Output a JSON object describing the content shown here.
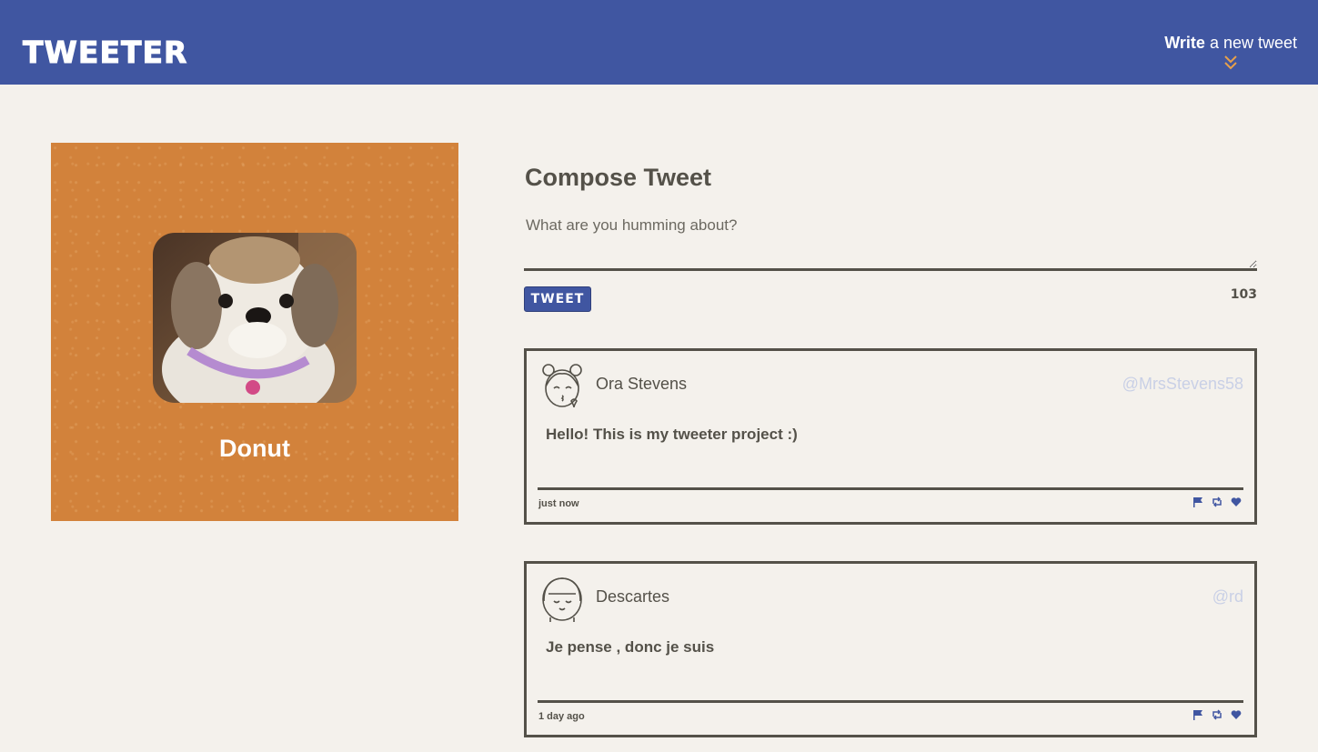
{
  "nav": {
    "brand": "TWEETER",
    "write_bold": "Write",
    "write_rest": " a new tweet"
  },
  "profile": {
    "name": "Donut"
  },
  "compose": {
    "title": "Compose Tweet",
    "placeholder": "What are you humming about?",
    "button_label": "TWEET",
    "counter": "103"
  },
  "tweets": [
    {
      "name": "Ora Stevens",
      "handle": "@MrsStevens58",
      "content": "Hello! This is my tweeter project :)",
      "time": "just now"
    },
    {
      "name": "Descartes",
      "handle": "@rd",
      "content": "Je pense , donc je suis",
      "time": "1 day ago"
    }
  ],
  "colors": {
    "nav_bg": "#4056a1",
    "page_bg": "#f4f1ec",
    "profile_bg": "#d2823b",
    "text": "#545149",
    "chevron": "#e8a04a",
    "handle": "#c9d0e6"
  },
  "icons": [
    "double-chevron-down-icon",
    "flag-icon",
    "retweet-icon",
    "heart-icon"
  ]
}
